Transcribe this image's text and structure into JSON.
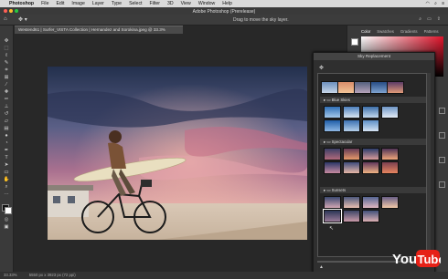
{
  "menubar": {
    "items": [
      "Photoshop",
      "File",
      "Edit",
      "Image",
      "Layer",
      "Type",
      "Select",
      "Filter",
      "3D",
      "View",
      "Window",
      "Help"
    ]
  },
  "window": {
    "title": "Adobe Photoshop (Prerelease)"
  },
  "options": {
    "hint": "Drag to move the sky layer."
  },
  "document": {
    "tab_label": "Westend61 | Surfer_VISTA Collection | Hernandez and Sorokina.jpeg @ 33.3% (RGB/8#) *"
  },
  "status": {
    "zoom": "33.33%",
    "doc_info": "5550 px x 3923 px (72 ppi)"
  },
  "right_panel": {
    "tabs": [
      "Color",
      "Swatches",
      "Gradients",
      "Patterns"
    ]
  },
  "sky_dialog": {
    "title": "Sky Replacement",
    "groups": [
      "Blue Skies",
      "Spectacular",
      "Sunsets"
    ]
  },
  "colors": {
    "accent_red": "#e0142b",
    "youtube_red": "#e62117"
  },
  "watermark": {
    "text": "YouTube"
  }
}
